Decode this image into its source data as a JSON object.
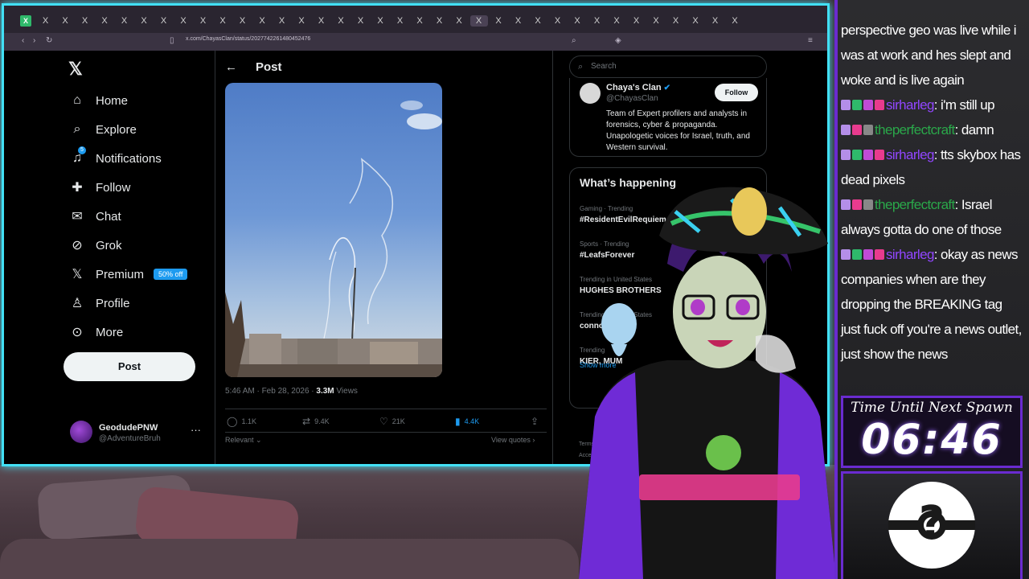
{
  "browser": {
    "address": "x.com/ChayasClan/status/2027742261480452476",
    "tab_icons": [
      "X",
      "X",
      "X",
      "X",
      "X",
      "X",
      "X",
      "X",
      "X",
      "X",
      "X",
      "X",
      "X",
      "X",
      "X",
      "X",
      "X",
      "X",
      "X",
      "X",
      "X",
      "X",
      "X",
      "X",
      "X",
      "X",
      "X",
      "X",
      "X",
      "X",
      "X",
      "X",
      "X",
      "X",
      "X",
      "X",
      "X"
    ]
  },
  "nav": {
    "items": [
      {
        "label": "Home",
        "icon": "home-icon"
      },
      {
        "label": "Explore",
        "icon": "search-icon"
      },
      {
        "label": "Notifications",
        "icon": "bell-icon",
        "badge": "5"
      },
      {
        "label": "Follow",
        "icon": "add-person-icon"
      },
      {
        "label": "Chat",
        "icon": "mail-icon"
      },
      {
        "label": "Grok",
        "icon": "grok-icon"
      },
      {
        "label": "Premium",
        "icon": "x-icon",
        "tag": "50% off"
      },
      {
        "label": "Profile",
        "icon": "person-icon"
      },
      {
        "label": "More",
        "icon": "more-circle-icon"
      }
    ],
    "post_button": "Post",
    "account": {
      "name": "GeodudePNW",
      "handle": "@AdventureBruh"
    }
  },
  "post": {
    "title": "Post",
    "time": "5:46 AM · Feb 28, 2026 · ",
    "views": "3.3M",
    "views_label": " Views",
    "replies": "1.1K",
    "reposts": "9.4K",
    "likes": "21K",
    "bookmarks": "4.4K",
    "relevant": "Relevant",
    "view_quotes": "View quotes"
  },
  "sidebar": {
    "search_placeholder": "Search",
    "card": {
      "name": "Chaya's Clan",
      "handle": "@ChayasClan",
      "follow": "Follow",
      "bio": "Team of Expert profilers and analysts in forensics, cyber & propaganda. Unapologetic voices for Israel, truth, and Western survival."
    },
    "trends_title": "What’s happening",
    "trends": [
      {
        "category": "Gaming · Trending",
        "name": "#ResidentEvilRequiem"
      },
      {
        "category": "Sports · Trending",
        "name": "#LeafsForever"
      },
      {
        "category": "Trending in United States",
        "name": "HUGHES BROTHERS"
      },
      {
        "category": "Trending in United States",
        "name": "connor"
      },
      {
        "category": "Trending",
        "name": "KIER, MUM"
      }
    ],
    "show_more": "Show more",
    "terms": "Terms of Service",
    "accessibility": "Accessibility"
  },
  "chat": {
    "messages": [
      {
        "user": "",
        "text": "perspective geo was live while i was at work and hes slept and woke and is live again",
        "badges": []
      },
      {
        "user": "sirharleg",
        "text": ": i'm still up",
        "badges": [
          "b1",
          "b2",
          "b3",
          "b4"
        ]
      },
      {
        "user": "theperfectcraft",
        "text": ": damn",
        "badges": [
          "b1",
          "b4",
          "b5"
        ]
      },
      {
        "user": "sirharleg",
        "text": ": tts skybox has dead pixels",
        "badges": [
          "b1",
          "b2",
          "b3",
          "b4"
        ]
      },
      {
        "user": "theperfectcraft",
        "text": ": Israel always gotta do one of those",
        "badges": [
          "b1",
          "b4",
          "b5"
        ]
      },
      {
        "user": "sirharleg",
        "text": ": okay as news companies when are they dropping the BREAKING tag just fuck off you're a news outlet, just show the news",
        "badges": [
          "b1",
          "b2",
          "b3",
          "b4"
        ]
      }
    ],
    "spawn_label": "Time Until Next Spawn",
    "spawn_time": "06:46"
  },
  "colors": {
    "accent": "#1d9bf0",
    "frame": "#42e0f5",
    "chat_frame": "#6a2bd0",
    "user_sirharleg": "#9146ff",
    "user_theperfectcraft": "#2aa84a"
  }
}
